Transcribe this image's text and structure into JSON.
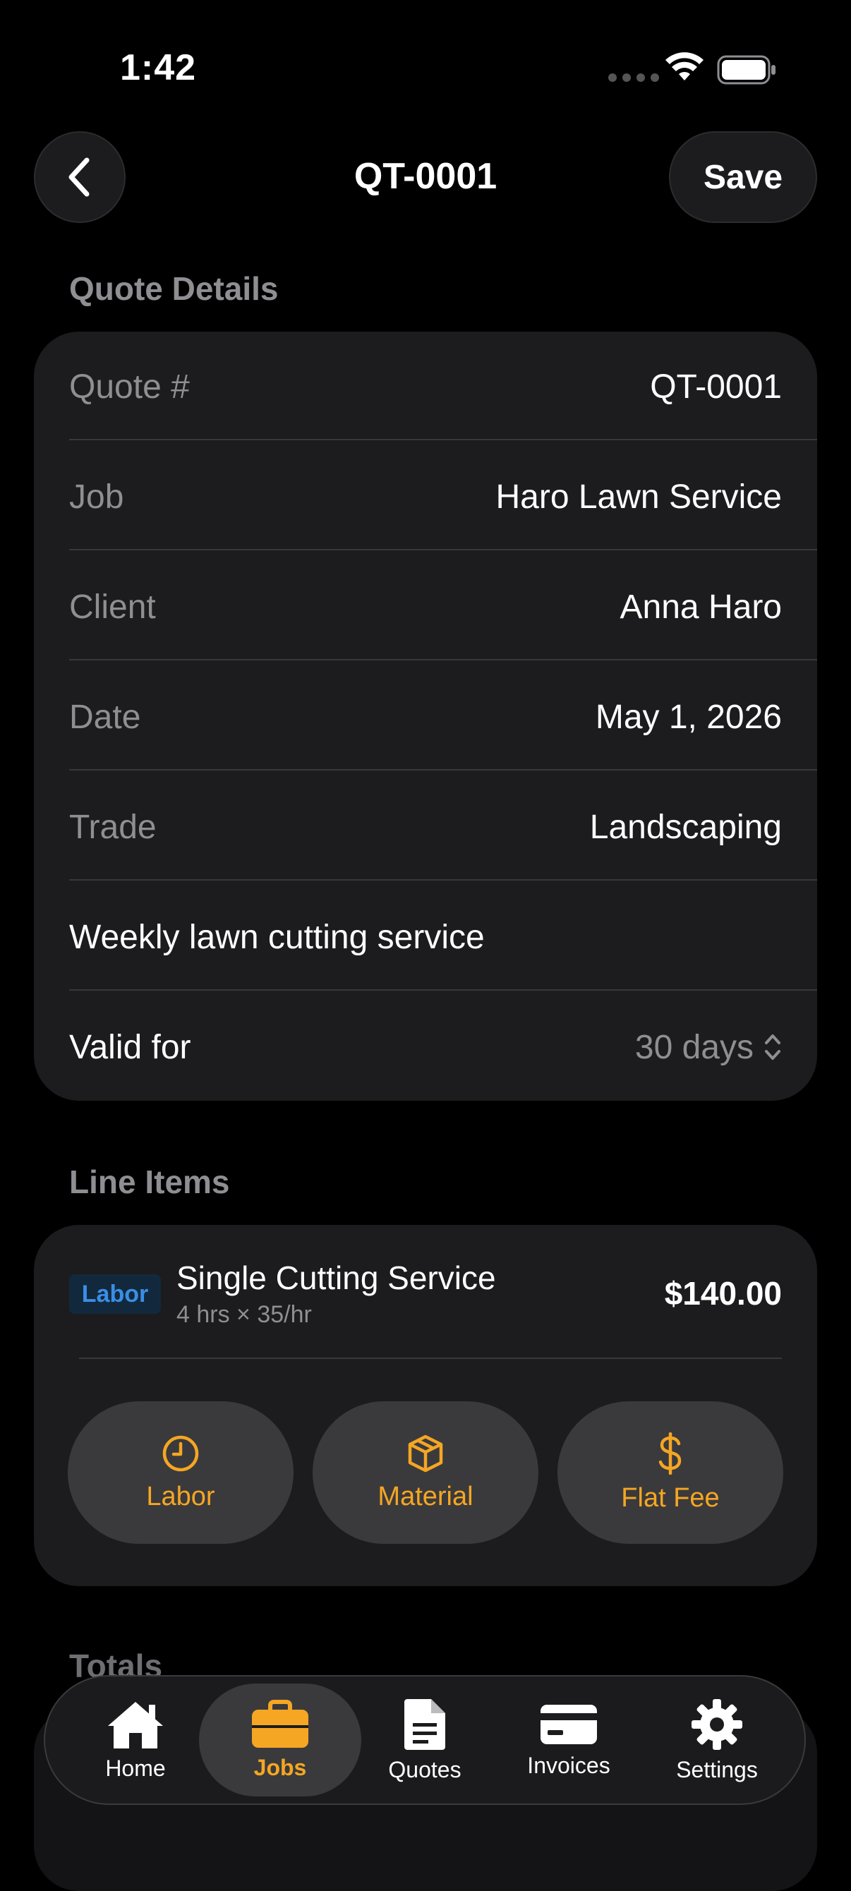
{
  "status_bar": {
    "time": "1:42"
  },
  "nav": {
    "title": "QT-0001",
    "save_label": "Save"
  },
  "quote_details": {
    "header": "Quote Details",
    "rows": [
      {
        "label": "Quote #",
        "value": "QT-0001"
      },
      {
        "label": "Job",
        "value": "Haro Lawn Service"
      },
      {
        "label": "Client",
        "value": "Anna Haro"
      },
      {
        "label": "Date",
        "value": "May 1, 2026"
      },
      {
        "label": "Trade",
        "value": "Landscaping"
      }
    ],
    "description": "Weekly lawn cutting service",
    "valid_for_label": "Valid for",
    "valid_for_value": "30 days"
  },
  "line_items": {
    "header": "Line Items",
    "items": [
      {
        "type": "Labor",
        "title": "Single Cutting Service",
        "detail": "4 hrs × 35/hr",
        "price": "$140.00"
      }
    ],
    "add_buttons": [
      {
        "label": "Labor",
        "icon": "clock-icon"
      },
      {
        "label": "Material",
        "icon": "box-icon"
      },
      {
        "label": "Flat Fee",
        "icon": "dollar-icon"
      }
    ]
  },
  "totals": {
    "header": "Totals"
  },
  "tab_bar": {
    "tabs": [
      {
        "label": "Home",
        "icon": "home-icon"
      },
      {
        "label": "Jobs",
        "icon": "briefcase-icon"
      },
      {
        "label": "Quotes",
        "icon": "document-icon"
      },
      {
        "label": "Invoices",
        "icon": "credit-card-icon"
      },
      {
        "label": "Settings",
        "icon": "gear-icon"
      }
    ],
    "active_index": 1
  },
  "colors": {
    "accent": "#f5a623",
    "card": "#1c1c1e",
    "secondary_text": "#8e8e93",
    "badge_text": "#3a8ee6"
  }
}
